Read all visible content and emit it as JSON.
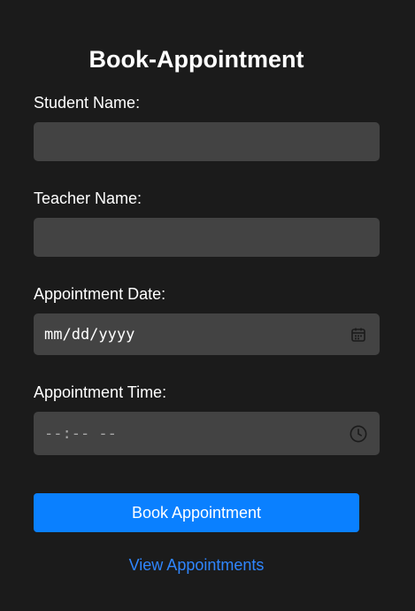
{
  "form": {
    "title": "Book-Appointment",
    "student_name": {
      "label": "Student Name:",
      "value": ""
    },
    "teacher_name": {
      "label": "Teacher Name:",
      "value": ""
    },
    "appointment_date": {
      "label": "Appointment Date:",
      "placeholder": "mm/dd/yyyy",
      "icon": "calendar-icon"
    },
    "appointment_time": {
      "label": "Appointment Time:",
      "placeholder": "--:-- --",
      "icon": "clock-icon"
    },
    "submit_label": "Book Appointment",
    "view_link_label": "View Appointments"
  },
  "colors": {
    "background": "#1b1b1b",
    "input_background": "#434343",
    "primary": "#0a80ff",
    "link": "#2f86ff"
  }
}
